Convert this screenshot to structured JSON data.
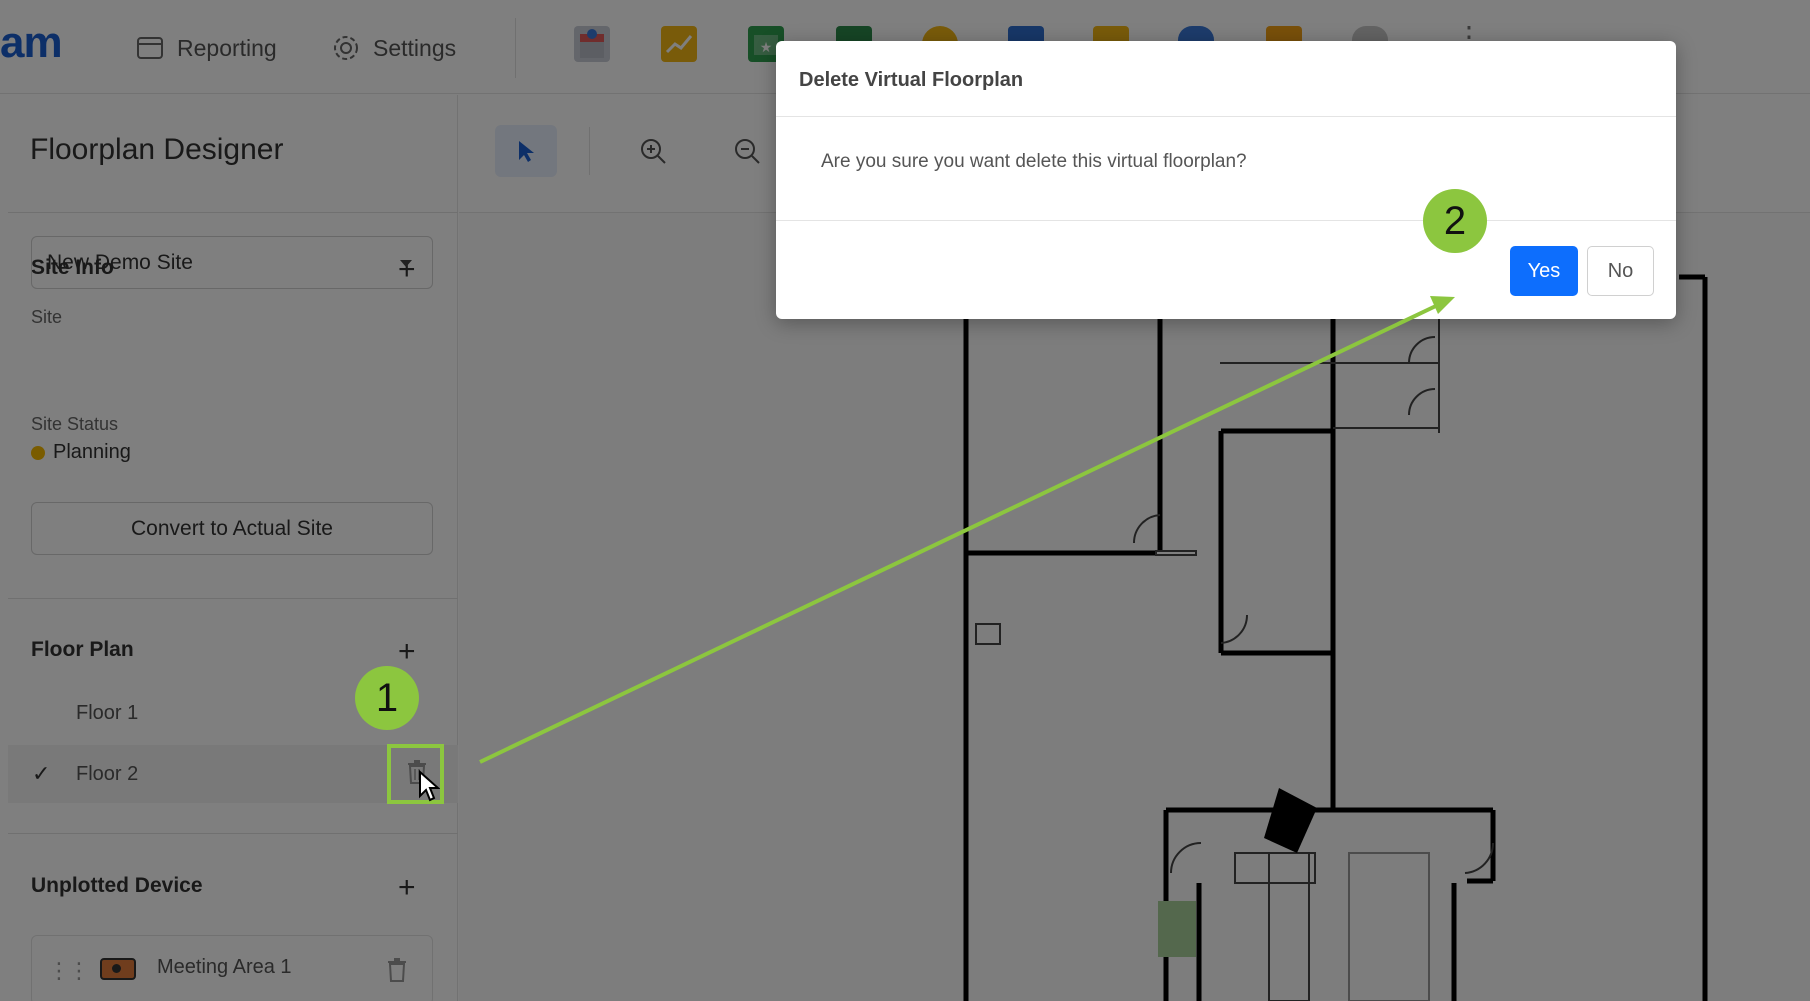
{
  "header": {
    "brand_text": "am",
    "nav": [
      {
        "label": "Reporting",
        "icon": "window-icon"
      },
      {
        "label": "Settings",
        "icon": "gear-icon"
      }
    ],
    "app_icons": [
      "store-icon",
      "chart-icon",
      "calendar-icon",
      "table-icon",
      "cloud-icon",
      "home-icon",
      "folder-icon",
      "database-icon",
      "edit-icon",
      "cylinder-icon"
    ],
    "more_label": "⋮"
  },
  "left_panel": {
    "title": "Floorplan Designer",
    "site_info": {
      "heading": "Site Info",
      "add_label": "+",
      "site_label": "Site",
      "site_value": "New Demo Site",
      "status_label": "Site Status",
      "status_value": "Planning",
      "status_color": "#f5b800",
      "convert_label": "Convert to Actual Site"
    },
    "floor_plan": {
      "heading": "Floor Plan",
      "add_label": "+",
      "floors": [
        {
          "label": "Floor 1",
          "selected": false
        },
        {
          "label": "Floor 2",
          "selected": true
        }
      ],
      "check_glyph": "✓"
    },
    "unplotted": {
      "heading": "Unplotted Device",
      "add_label": "+",
      "devices": [
        {
          "label": "Meeting Area 1"
        }
      ]
    }
  },
  "toolbar": {
    "tools": [
      "pointer-icon",
      "zoom-in-icon",
      "zoom-out-icon"
    ]
  },
  "dialog": {
    "title": "Delete Virtual Floorplan",
    "message": "Are you sure you want delete this virtual floorplan?",
    "yes_label": "Yes",
    "no_label": "No",
    "yes_color": "#0d6efd"
  },
  "annotations": {
    "step1": "1",
    "step2": "2",
    "color": "#8cc63f"
  }
}
